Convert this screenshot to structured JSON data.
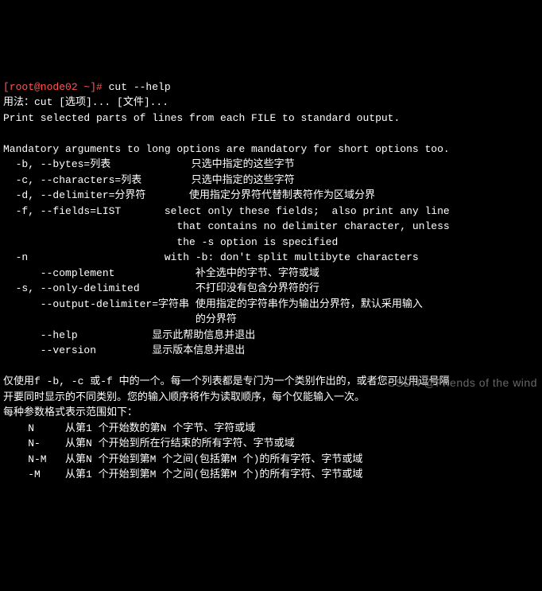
{
  "prompt": {
    "user_host": "[root@node02 ~]# ",
    "command": "cut --help"
  },
  "lines": {
    "usage": "用法：cut [选项]... [文件]...",
    "desc": "Print selected parts of lines from each FILE to standard output.",
    "blank": "",
    "mandatory": "Mandatory arguments to long options are mandatory for short options too.",
    "opt_b": "  -b, --bytes=列表             只选中指定的这些字节",
    "opt_c": "  -c, --characters=列表        只选中指定的这些字符",
    "opt_d": "  -d, --delimiter=分界符       使用指定分界符代替制表符作为区域分界",
    "opt_f1": "  -f, --fields=LIST       select only these fields;  also print any line",
    "opt_f2": "                            that contains no delimiter character, unless",
    "opt_f3": "                            the -s option is specified",
    "opt_n": "  -n                      with -b: don't split multibyte characters",
    "opt_comp": "      --complement             补全选中的字节、字符或域",
    "opt_s": "  -s, --only-delimited         不打印没有包含分界符的行",
    "opt_od1": "      --output-delimiter=字符串 使用指定的字符串作为输出分界符，默认采用输入",
    "opt_od2": "                               的分界符",
    "opt_help": "      --help            显示此帮助信息并退出",
    "opt_ver": "      --version         显示版本信息并退出",
    "note1": "仅使用f -b, -c 或-f 中的一个。每一个列表都是专门为一个类别作出的，或者您可以用逗号隔",
    "note2": "开要同时显示的不同类别。您的输入顺序将作为读取顺序，每个仅能输入一次。",
    "note3": "每种参数格式表示范围如下：",
    "rng_n": "    N     从第1 个开始数的第N 个字节、字符或域",
    "rng_n_": "    N-    从第N 个开始到所在行结束的所有字符、字节或域",
    "rng_nm": "    N-M   从第N 个开始到第M 个之间(包括第M 个)的所有字符、字节或域",
    "rng__m": "    -M    从第1 个开始到第M 个之间(包括第M 个)的所有字符、字节或域"
  },
  "watermark": "CSDN @Friends of the wind"
}
